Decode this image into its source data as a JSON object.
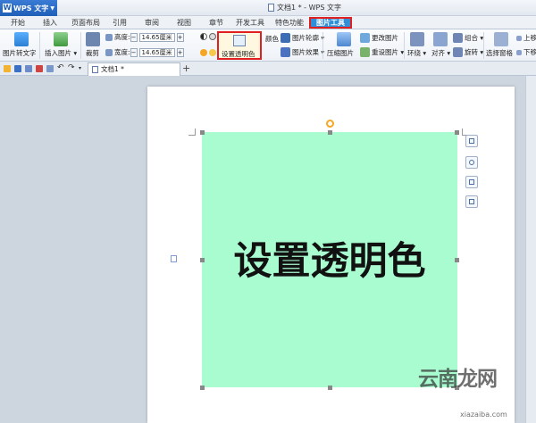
{
  "app": {
    "name": "WPS 文字",
    "window_title": "文档1 * - WPS 文字"
  },
  "menu_tabs": [
    "开始",
    "插入",
    "页面布局",
    "引用",
    "审阅",
    "视图",
    "章节",
    "开发工具",
    "特色功能",
    "图片工具"
  ],
  "active_tab": "图片工具",
  "ribbon": {
    "pic_to_text": "图片转文字",
    "insert_pic": "插入图片",
    "crop": "裁剪",
    "height_label": "高度:",
    "height_value": "14.65厘米",
    "width_label": "宽度:",
    "width_value": "14.65厘米",
    "set_transparent": "设置透明色",
    "color": "颜色",
    "pic_outline": "图片轮廓",
    "pic_effect": "图片效果",
    "change_pic": "更改图片",
    "compress_pic": "压缩图片",
    "reset_pic": "重设图片",
    "wrap": "环绕",
    "align": "对齐",
    "group": "组合",
    "rotate": "旋转",
    "selection_pane": "选择窗格",
    "up_one_layer": "上移",
    "down_one_layer": "下移"
  },
  "doc_tab": "文档1 *",
  "image": {
    "text": "设置透明色",
    "bg_color": "#a8fcd0"
  },
  "watermark": {
    "main": "云南龙网",
    "url": "xiazaiba.com"
  },
  "colors": {
    "active_tab": "#2f8fd8",
    "highlight": "#e02020"
  }
}
